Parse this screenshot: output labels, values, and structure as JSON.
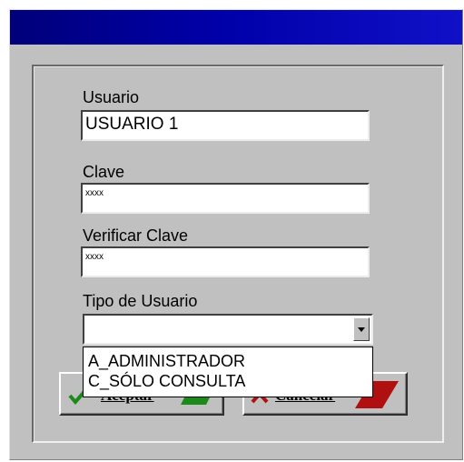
{
  "form": {
    "usuario_label": "Usuario",
    "usuario_value": "USUARIO 1",
    "clave_label": "Clave",
    "clave_value": "xxxx",
    "verificar_label": "Verificar Clave",
    "verificar_value": "xxxx",
    "tipo_label": "Tipo de Usuario",
    "tipo_value": ""
  },
  "dropdown": {
    "options": [
      "A_ADMINISTRADOR",
      "C_SÓLO CONSULTA"
    ]
  },
  "buttons": {
    "aceptar": "Aceptar",
    "cancelar": "Cancelar"
  },
  "colors": {
    "title_bar": "#0000a8",
    "dialog_bg": "#c0c0c0",
    "accept_icon": "#1a8a1a",
    "cancel_icon": "#b01010"
  },
  "icons": {
    "aceptar": "checkmark-icon",
    "cancelar": "x-mark-icon"
  }
}
